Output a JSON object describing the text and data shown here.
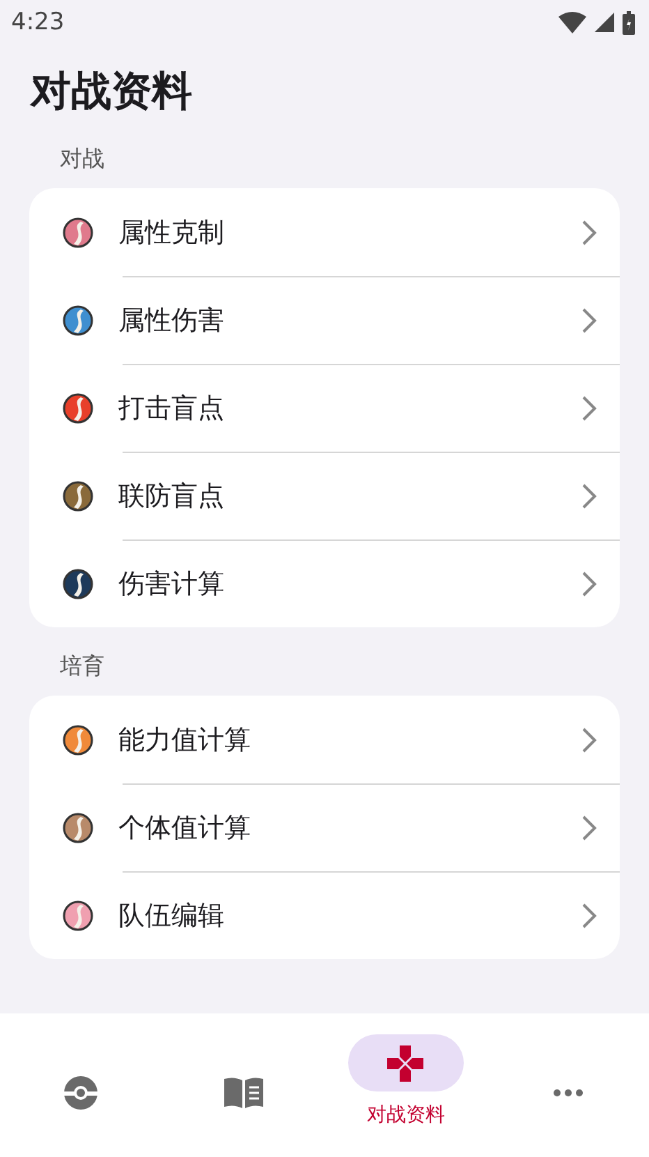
{
  "status_bar": {
    "time": "4:23"
  },
  "title": "对战资料",
  "sections": [
    {
      "label": "对战",
      "items": [
        {
          "label": "属性克制",
          "color": "#e07a8c"
        },
        {
          "label": "属性伤害",
          "color": "#3f8fd0"
        },
        {
          "label": "打击盲点",
          "color": "#e8402a"
        },
        {
          "label": "联防盲点",
          "color": "#8a6a3a"
        },
        {
          "label": "伤害计算",
          "color": "#1e3a5a"
        }
      ]
    },
    {
      "label": "培育",
      "items": [
        {
          "label": "能力值计算",
          "color": "#f08a3a"
        },
        {
          "label": "个体值计算",
          "color": "#b88a6a"
        },
        {
          "label": "队伍编辑",
          "color": "#f0a0b0"
        }
      ]
    }
  ],
  "nav": [
    {
      "kind": "ball",
      "selected": false
    },
    {
      "kind": "book",
      "selected": false
    },
    {
      "kind": "dpad",
      "selected": true,
      "label": "对战资料"
    },
    {
      "kind": "more",
      "selected": false
    }
  ]
}
